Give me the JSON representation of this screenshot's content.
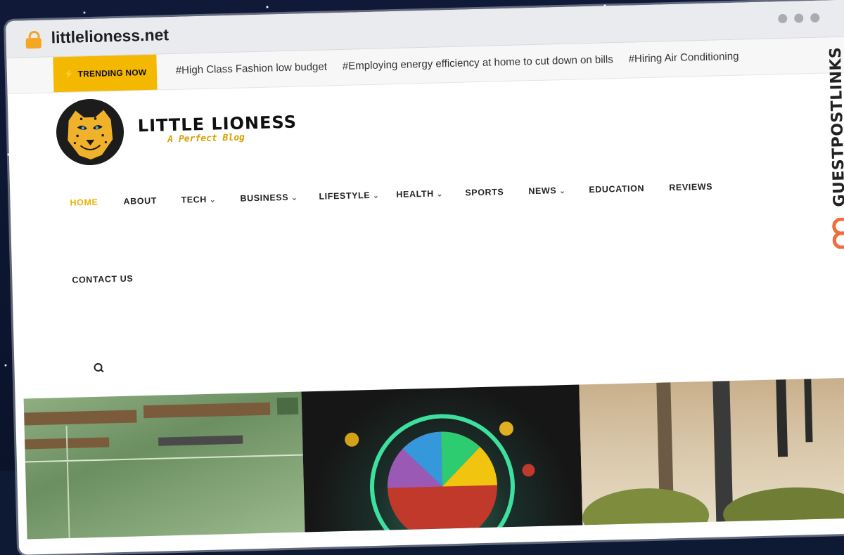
{
  "browser": {
    "url": "littlelioness.net"
  },
  "trending": {
    "badge": "TRENDING NOW",
    "items": [
      "#High Class Fashion low budget",
      "#Employing energy efficiency at home to cut down on bills",
      "#Hiring Air Conditioning"
    ]
  },
  "site": {
    "name": "LITTLE LIONESS",
    "tagline": "A Perfect Blog"
  },
  "nav": {
    "items": [
      {
        "label": "HOME",
        "active": true
      },
      {
        "label": "ABOUT"
      },
      {
        "label": "TECH",
        "has_menu": true
      },
      {
        "label": "BUSINESS",
        "has_menu": true
      },
      {
        "label": "LIFESTYLE",
        "has_menu": true
      },
      {
        "label": "HEALTH",
        "has_menu": true
      },
      {
        "label": "SPORTS"
      },
      {
        "label": "NEWS",
        "has_menu": true
      },
      {
        "label": "EDUCATION"
      },
      {
        "label": "REVIEWS"
      },
      {
        "label": "CONTACT US"
      }
    ]
  },
  "watermark": {
    "label": "GUESTPOSTLINKS"
  },
  "colors": {
    "accent": "#f5b800",
    "active_nav": "#e8b300",
    "brand_tagline": "#d5a000",
    "watermark_icon": "#f36b3a"
  },
  "icons": {
    "lock": "lock-icon",
    "trend": "lightning-icon",
    "search": "search-icon",
    "chevron": "chevron-down-icon",
    "watermark": "link-icon"
  }
}
